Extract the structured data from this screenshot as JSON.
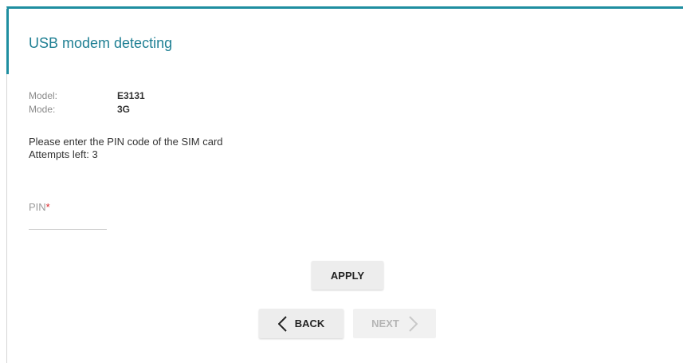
{
  "page": {
    "title": "USB modem detecting"
  },
  "info": {
    "model_label": "Model:",
    "model_value": "E3131",
    "mode_label": "Mode:",
    "mode_value": "3G"
  },
  "message": {
    "line1": "Please enter the PIN code of the SIM card",
    "line2": "Attempts left: 3"
  },
  "pin": {
    "label": "PIN",
    "required_mark": "*",
    "value": "",
    "placeholder": ""
  },
  "buttons": {
    "apply": "APPLY",
    "back": "BACK",
    "next": "NEXT"
  },
  "icons": {
    "back": "chevron-left-icon",
    "next": "chevron-right-icon"
  },
  "colors": {
    "accent": "#1e8ea0",
    "title": "#1e7f93",
    "required": "#d9262a",
    "disabled_text": "#b5b5b5"
  }
}
